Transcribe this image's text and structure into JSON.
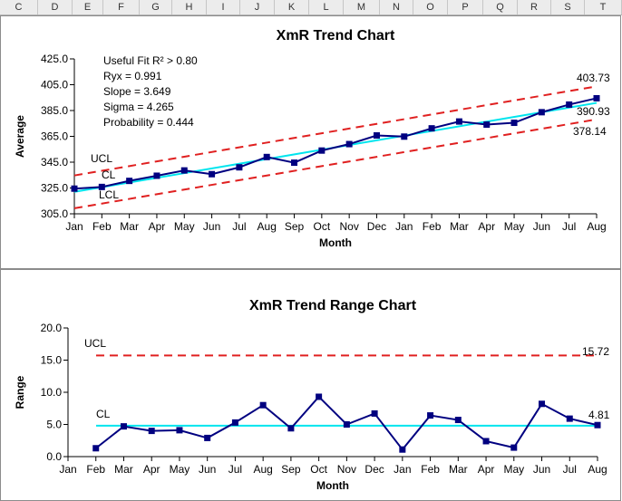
{
  "spreadsheet": {
    "columns": [
      "C",
      "D",
      "E",
      "F",
      "G",
      "H",
      "I",
      "J",
      "K",
      "L",
      "M",
      "N",
      "O",
      "P",
      "Q",
      "R",
      "S",
      "T"
    ]
  },
  "chart_data": [
    {
      "type": "line",
      "title": "XmR Trend Chart",
      "xlabel": "Month",
      "ylabel": "Average",
      "categories": [
        "Jan",
        "Feb",
        "Mar",
        "Apr",
        "May",
        "Jun",
        "Jul",
        "Aug",
        "Sep",
        "Oct",
        "Nov",
        "Dec",
        "Jan",
        "Feb",
        "Mar",
        "Apr",
        "May",
        "Jun",
        "Jul",
        "Aug"
      ],
      "ylim": [
        305.0,
        425.0
      ],
      "yticks": [
        "425.0",
        "405.0",
        "385.0",
        "365.0",
        "345.0",
        "325.0",
        "305.0"
      ],
      "grid": false,
      "series": [
        {
          "values": [
            324.5,
            325.8,
            330.5,
            334.5,
            338.6,
            335.7,
            341.0,
            349.0,
            344.6,
            354.0,
            359.0,
            365.7,
            364.8,
            371.2,
            376.5,
            374.1,
            375.5,
            383.7,
            389.6,
            394.5
          ],
          "color": "#000080"
        }
      ],
      "lines": [
        {
          "label": "UCL",
          "from": 334.7,
          "to": 403.73,
          "color": "#e02020",
          "style": "dashed"
        },
        {
          "label": "CL",
          "from": 322.0,
          "to": 390.93,
          "color": "#00e5ee",
          "style": "solid"
        },
        {
          "label": "LCL",
          "from": 309.3,
          "to": 378.14,
          "color": "#e02020",
          "style": "dashed"
        }
      ],
      "line_end_labels": [
        "403.73",
        "390.93",
        "378.14"
      ],
      "annotations": [
        "Useful Fit R² > 0.80",
        "Ryx = 0.991",
        "Slope = 3.649",
        "Sigma = 4.265",
        "Probability = 0.444"
      ]
    },
    {
      "type": "line",
      "title": "XmR Trend Range Chart",
      "xlabel": "Month",
      "ylabel": "Range",
      "categories": [
        "Jan",
        "Feb",
        "Mar",
        "Apr",
        "May",
        "Jun",
        "Jul",
        "Aug",
        "Sep",
        "Oct",
        "Nov",
        "Dec",
        "Jan",
        "Feb",
        "Mar",
        "Apr",
        "May",
        "Jun",
        "Jul",
        "Aug"
      ],
      "ylim": [
        0.0,
        20.0
      ],
      "yticks": [
        "20.0",
        "15.0",
        "10.0",
        "5.0",
        "0.0"
      ],
      "grid": false,
      "series": [
        {
          "start_index": 1,
          "values": [
            1.3,
            4.7,
            4.0,
            4.1,
            2.9,
            5.3,
            8.0,
            4.4,
            9.3,
            5.0,
            6.7,
            1.1,
            6.4,
            5.7,
            2.4,
            1.4,
            8.2,
            5.9,
            4.9
          ],
          "color": "#000080"
        }
      ],
      "lines": [
        {
          "label": "UCL",
          "value": 15.72,
          "color": "#e02020",
          "style": "dashed"
        },
        {
          "label": "CL",
          "value": 4.81,
          "color": "#00e5ee",
          "style": "solid"
        }
      ],
      "line_end_labels": [
        "15.72",
        "4.81"
      ]
    }
  ]
}
